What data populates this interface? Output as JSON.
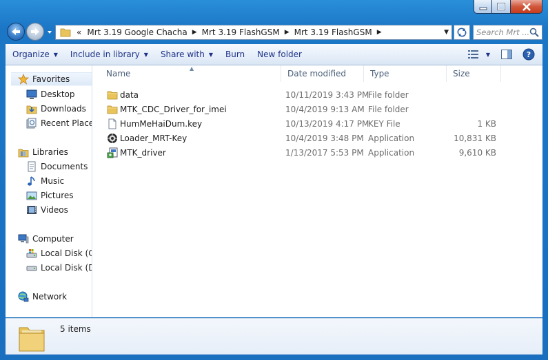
{
  "window": {
    "minimize_icon": "minimize-icon",
    "maximize_icon": "maximize-icon",
    "close_icon": "close-icon"
  },
  "address_bar": {
    "overflow": "«",
    "crumbs": [
      "Mrt 3.19 Google Chacha",
      "Mrt 3.19 FlashGSM",
      "Mrt 3.19 FlashGSM"
    ]
  },
  "search": {
    "placeholder": "Search Mrt ..."
  },
  "toolbar": {
    "organize": "Organize",
    "include_in_library": "Include in library",
    "share_with": "Share with",
    "burn": "Burn",
    "new_folder": "New folder"
  },
  "nav_pane": {
    "favorites": {
      "label": "Favorites",
      "items": [
        "Desktop",
        "Downloads",
        "Recent Places"
      ]
    },
    "libraries": {
      "label": "Libraries",
      "items": [
        "Documents",
        "Music",
        "Pictures",
        "Videos"
      ]
    },
    "computer": {
      "label": "Computer",
      "items": [
        "Local Disk (C:)",
        "Local Disk (D:)"
      ]
    },
    "network": {
      "label": "Network"
    }
  },
  "columns": {
    "name": "Name",
    "date": "Date modified",
    "type": "Type",
    "size": "Size"
  },
  "files": [
    {
      "name": "data",
      "date": "10/11/2019 3:43 PM",
      "type": "File folder",
      "size": "",
      "icon": "folder-icon"
    },
    {
      "name": "MTK_CDC_Driver_for_imei",
      "date": "10/4/2019 9:13 AM",
      "type": "File folder",
      "size": "",
      "icon": "folder-icon"
    },
    {
      "name": "HumMeHaiDum.key",
      "date": "10/13/2019 4:17 PM",
      "type": "KEY File",
      "size": "1 KB",
      "icon": "file-icon"
    },
    {
      "name": "Loader_MRT-Key",
      "date": "10/4/2019 3:48 PM",
      "type": "Application",
      "size": "10,831 KB",
      "icon": "app-loader-icon"
    },
    {
      "name": "MTK_driver",
      "date": "1/13/2017 5:53 PM",
      "type": "Application",
      "size": "9,610 KB",
      "icon": "installer-icon"
    }
  ],
  "details": {
    "count": "5 items"
  }
}
